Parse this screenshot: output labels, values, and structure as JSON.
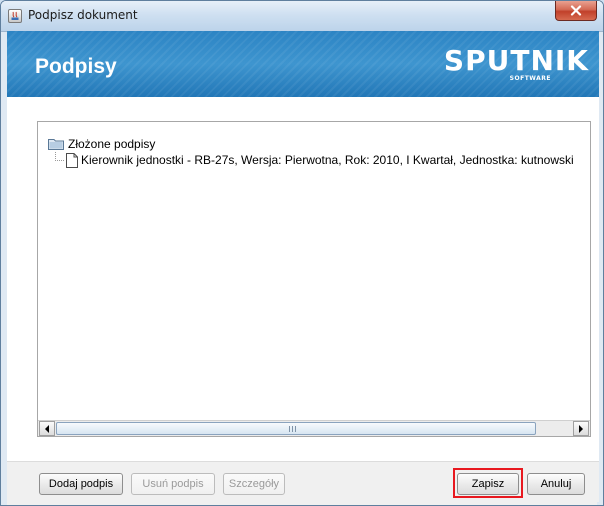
{
  "window": {
    "title": "Podpisz dokument"
  },
  "banner": {
    "title": "Podpisy",
    "logo_main": "SPUTNIK",
    "logo_sub": "SOFTWARE",
    "color": "#2e86c5"
  },
  "tree": {
    "root_label": "Złożone podpisy",
    "items": [
      {
        "label": "Kierownik jednostki - RB-27s, Wersja: Pierwotna, Rok: 2010, I Kwartał, Jednostka: kutnowski"
      }
    ]
  },
  "buttons": {
    "add": "Dodaj podpis",
    "remove": "Usuń podpis",
    "details": "Szczegóły",
    "save": "Zapisz",
    "cancel": "Anuluj"
  },
  "colors": {
    "highlight": "#e8181f",
    "close_button": "#c94a35"
  },
  "icons": {
    "window": "java-app-icon",
    "close": "close-icon",
    "folder": "folder-icon",
    "document": "document-icon",
    "scroll_left": "arrow-left-icon",
    "scroll_right": "arrow-right-icon"
  }
}
